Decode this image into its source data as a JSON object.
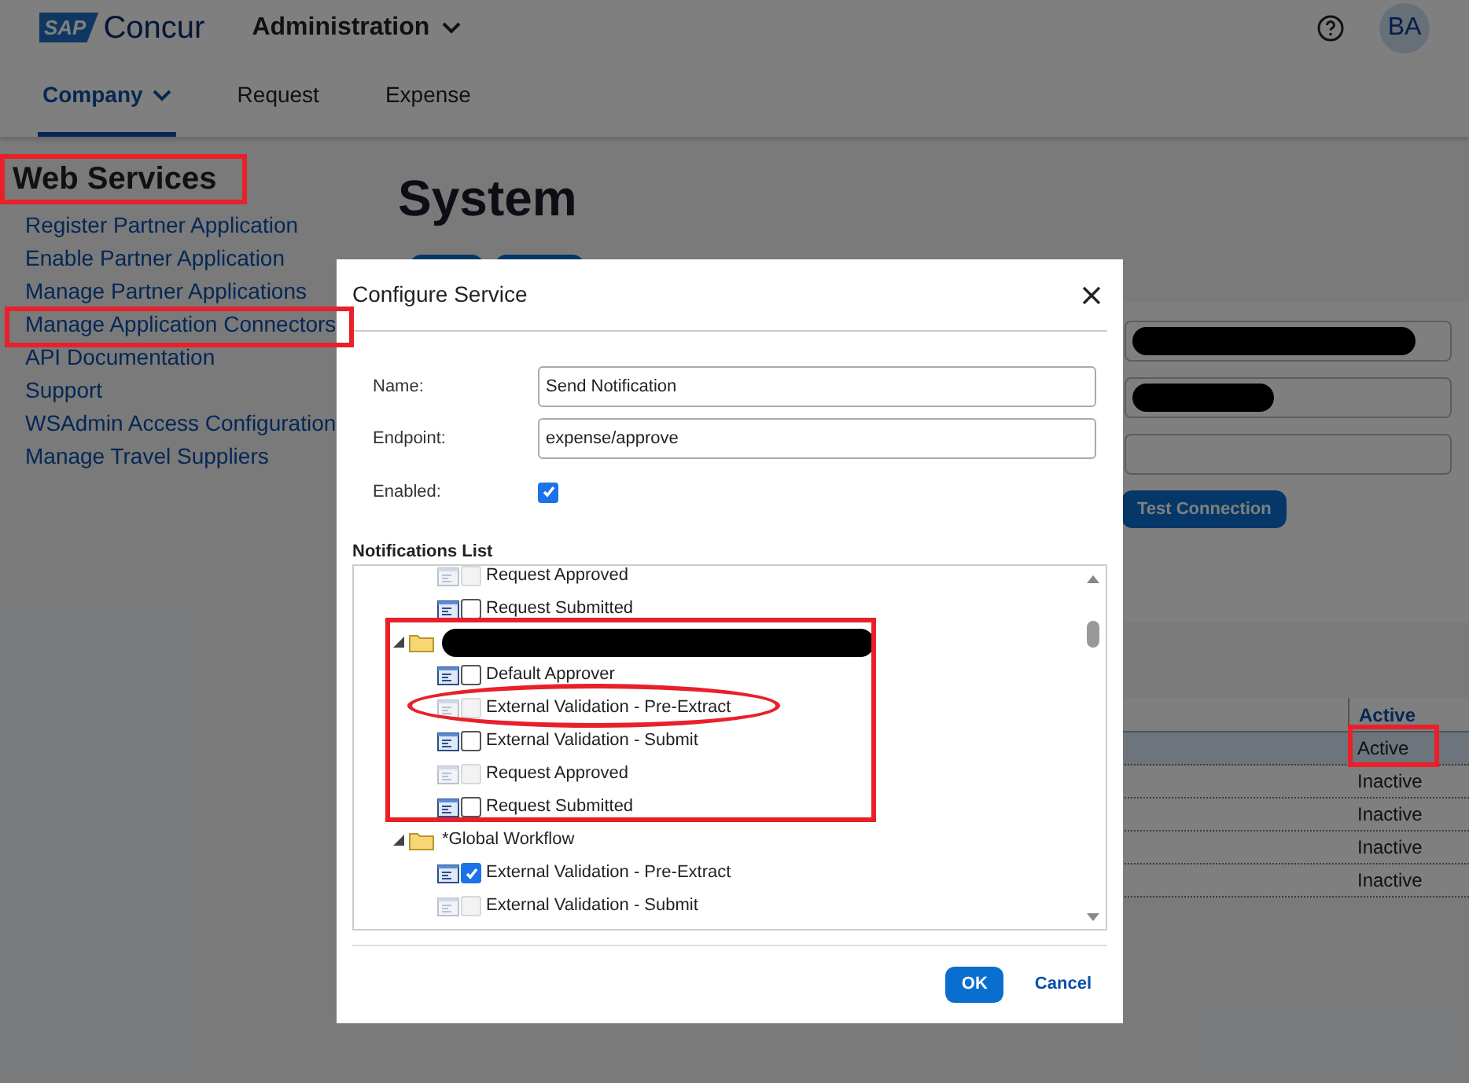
{
  "header": {
    "logo_mark": "SAP",
    "logo_name": "Concur",
    "app_menu": "Administration",
    "avatar": "BA"
  },
  "nav": [
    {
      "label": "Company",
      "selected": true,
      "dropdown": true
    },
    {
      "label": "Request",
      "selected": false,
      "dropdown": false
    },
    {
      "label": "Expense",
      "selected": false,
      "dropdown": false
    }
  ],
  "sidebar": {
    "title": "Web Services",
    "items": [
      "Register Partner Application",
      "Enable Partner Application",
      "Manage Partner Applications",
      "Manage Application Connectors",
      "API Documentation",
      "Support",
      "WSAdmin Access Configuration",
      "Manage Travel Suppliers"
    ]
  },
  "page": {
    "title": "System",
    "fields": [
      {
        "redacted": true
      },
      {
        "redacted": true
      },
      {
        "redacted": false
      }
    ],
    "test_button": "Test Connection"
  },
  "table": {
    "column": "Active",
    "rows": [
      {
        "status": "Active",
        "selected": true
      },
      {
        "status": "Inactive",
        "selected": false
      },
      {
        "status": "Inactive",
        "selected": false
      },
      {
        "status": "Inactive",
        "selected": false
      },
      {
        "status": "Inactive",
        "selected": false
      }
    ]
  },
  "dialog": {
    "title": "Configure Service",
    "name_label": "Name:",
    "name_value": "Send Notification",
    "endpoint_label": "Endpoint:",
    "endpoint_value": "expense/approve",
    "enabled_label": "Enabled:",
    "enabled": true,
    "list_title": "Notifications List",
    "tree": [
      {
        "kind": "item",
        "label": "Request Approved",
        "enabled": false,
        "checked": false
      },
      {
        "kind": "item",
        "label": "Request Submitted",
        "enabled": true,
        "checked": false
      },
      {
        "kind": "folder",
        "redacted": true,
        "expanded": true,
        "children": [
          {
            "kind": "item",
            "label": "Default Approver",
            "enabled": true,
            "checked": false
          },
          {
            "kind": "item",
            "label": "External Validation - Pre-Extract",
            "enabled": false,
            "checked": false
          },
          {
            "kind": "item",
            "label": "External Validation - Submit",
            "enabled": true,
            "checked": false
          },
          {
            "kind": "item",
            "label": "Request Approved",
            "enabled": false,
            "checked": false
          },
          {
            "kind": "item",
            "label": "Request Submitted",
            "enabled": true,
            "checked": false
          }
        ]
      },
      {
        "kind": "folder",
        "label": "*Global Workflow",
        "redacted": false,
        "expanded": true,
        "children": [
          {
            "kind": "item",
            "label": "External Validation - Pre-Extract",
            "enabled": true,
            "checked": true
          },
          {
            "kind": "item",
            "label": "External Validation - Submit",
            "enabled": false,
            "checked": false
          }
        ]
      }
    ],
    "ok": "OK",
    "cancel": "Cancel"
  }
}
